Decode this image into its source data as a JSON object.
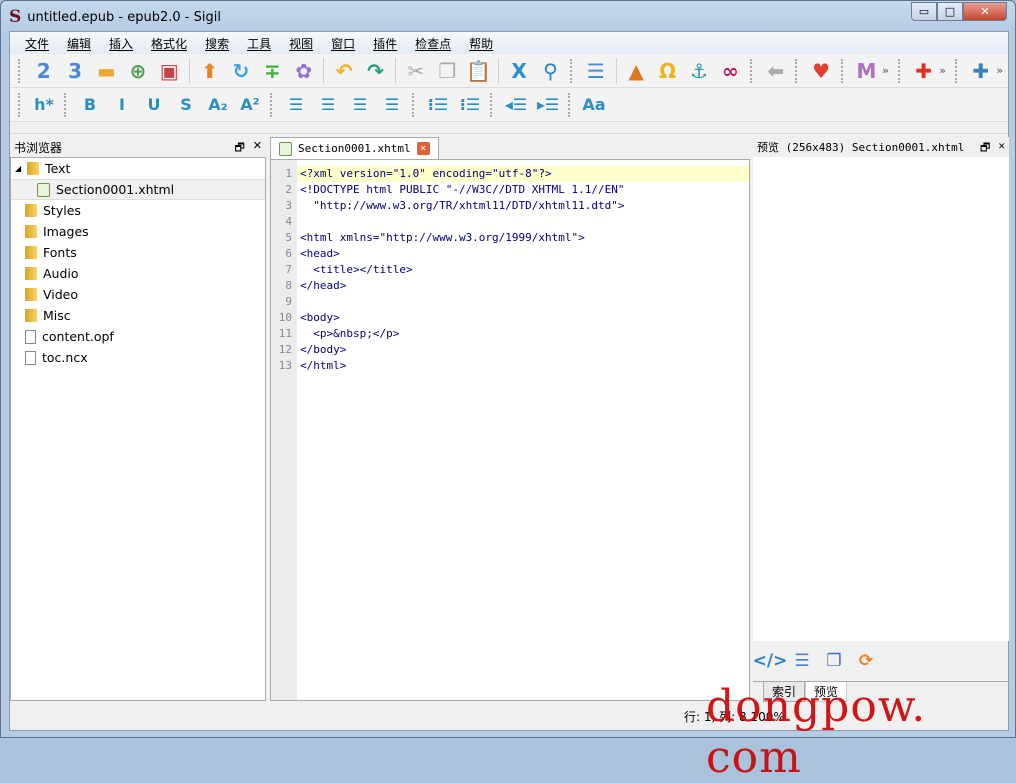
{
  "window": {
    "title": "untitled.epub - epub2.0 - Sigil",
    "logo": "S",
    "minimize": "▭",
    "maximize": "□",
    "close": "✕"
  },
  "menu": [
    "文件",
    "编辑",
    "插入",
    "格式化",
    "搜索",
    "工具",
    "视图",
    "窗口",
    "插件",
    "检查点",
    "帮助"
  ],
  "toolbar1": [
    {
      "name": "add-section-2-icon",
      "g": "2",
      "c": "#4a8ad8"
    },
    {
      "name": "add-section-3-icon",
      "g": "3",
      "c": "#4a8ad8"
    },
    {
      "name": "open-folder-icon",
      "g": "▬",
      "c": "#f0a830"
    },
    {
      "name": "add-file-icon",
      "g": "⊕",
      "c": "#4aa050"
    },
    {
      "name": "save-icon",
      "g": "▣",
      "c": "#c84048"
    },
    {
      "sep": true
    },
    {
      "name": "up-arrow-icon",
      "g": "⬆",
      "c": "#f08020"
    },
    {
      "name": "refresh-icon",
      "g": "↻",
      "c": "#40a0e0"
    },
    {
      "name": "split-icon",
      "g": "∓",
      "c": "#40b040"
    },
    {
      "name": "settings-icon",
      "g": "✿",
      "c": "#9070d0"
    },
    {
      "sep": true
    },
    {
      "name": "undo-icon",
      "g": "↶",
      "c": "#f0b020"
    },
    {
      "name": "redo-icon",
      "g": "↷",
      "c": "#20a080"
    },
    {
      "sep": true
    },
    {
      "name": "cut-icon",
      "g": "✂",
      "c": "#aaa"
    },
    {
      "name": "copy-icon",
      "g": "❐",
      "c": "#aaa"
    },
    {
      "name": "paste-icon",
      "g": "📋",
      "c": "#4a8ad8"
    },
    {
      "sep": true
    },
    {
      "name": "x-tool-icon",
      "g": "X",
      "c": "#2a90d0"
    },
    {
      "name": "search-icon",
      "g": "⚲",
      "c": "#2a80c0"
    },
    {
      "grip": true
    },
    {
      "name": "toc-icon",
      "g": "☰",
      "c": "#4a8ad8"
    },
    {
      "sep": true
    },
    {
      "name": "image-icon",
      "g": "▲",
      "c": "#e07820"
    },
    {
      "name": "omega-icon",
      "g": "Ω",
      "c": "#f0b020"
    },
    {
      "name": "anchor-icon",
      "g": "⚓",
      "c": "#20a0b0"
    },
    {
      "name": "link-icon",
      "g": "∞",
      "c": "#c01860"
    },
    {
      "grip": true
    },
    {
      "name": "back-arrow-icon",
      "g": "⬅",
      "c": "#aaa"
    },
    {
      "grip": true
    },
    {
      "name": "heart-icon",
      "g": "♥",
      "c": "#e04030"
    },
    {
      "grip": true
    },
    {
      "name": "m-plugin-icon",
      "g": "M",
      "c": "#b070c0"
    },
    {
      "chev": "»"
    },
    {
      "grip": true
    },
    {
      "name": "plugin-1-icon",
      "g": "✚",
      "c": "#e03020"
    },
    {
      "chev": "»"
    },
    {
      "grip": true
    },
    {
      "name": "plugin-6-icon",
      "g": "✚",
      "c": "#3a80c0"
    },
    {
      "chev": "»"
    }
  ],
  "toolbar2": [
    {
      "name": "heading-icon",
      "g": "h*",
      "c": "#2a90c0"
    },
    {
      "grip": true
    },
    {
      "name": "bold-icon",
      "g": "B",
      "c": "#2a90c0"
    },
    {
      "name": "italic-icon",
      "g": "I",
      "c": "#2a90c0"
    },
    {
      "name": "underline-icon",
      "g": "U",
      "c": "#2a90c0"
    },
    {
      "name": "strikethrough-icon",
      "g": "S",
      "c": "#2a90c0"
    },
    {
      "name": "subscript-icon",
      "g": "A₂",
      "c": "#2a90c0"
    },
    {
      "name": "superscript-icon",
      "g": "A²",
      "c": "#2a90c0"
    },
    {
      "grip": true
    },
    {
      "name": "align-left-icon",
      "g": "☰",
      "c": "#2a90c0"
    },
    {
      "name": "align-center-icon",
      "g": "☰",
      "c": "#2a90c0"
    },
    {
      "name": "align-right-icon",
      "g": "☰",
      "c": "#2a90c0"
    },
    {
      "name": "justify-icon",
      "g": "☰",
      "c": "#2a90c0"
    },
    {
      "grip": true
    },
    {
      "name": "bullet-list-icon",
      "g": "⁝☰",
      "c": "#2a90c0"
    },
    {
      "name": "numbered-list-icon",
      "g": "⁝☰",
      "c": "#2a90c0"
    },
    {
      "grip": true
    },
    {
      "name": "outdent-icon",
      "g": "◂☰",
      "c": "#2a90c0"
    },
    {
      "name": "indent-icon",
      "g": "▸☰",
      "c": "#2a90c0"
    },
    {
      "grip": true
    },
    {
      "name": "text-case-icon",
      "g": "Aa",
      "c": "#2a90c0"
    }
  ],
  "book_browser": {
    "title": "书浏览器",
    "float": "🗗",
    "close": "✕",
    "items": [
      {
        "label": "Text",
        "type": "folder",
        "expanded": "◢"
      },
      {
        "label": "Section0001.xhtml",
        "type": "xhtml",
        "selected": true
      },
      {
        "label": "Styles",
        "type": "folder"
      },
      {
        "label": "Images",
        "type": "folder"
      },
      {
        "label": "Fonts",
        "type": "folder"
      },
      {
        "label": "Audio",
        "type": "folder"
      },
      {
        "label": "Video",
        "type": "folder"
      },
      {
        "label": "Misc",
        "type": "folder"
      },
      {
        "label": "content.opf",
        "type": "file"
      },
      {
        "label": "toc.ncx",
        "type": "file"
      }
    ]
  },
  "editor": {
    "tab": "Section0001.xhtml",
    "tab_close": "✕",
    "lines": [
      "<?xml version=\"1.0\" encoding=\"utf-8\"?>",
      "<!DOCTYPE html PUBLIC \"-//W3C//DTD XHTML 1.1//EN\"",
      "  \"http://www.w3.org/TR/xhtml11/DTD/xhtml11.dtd\">",
      "",
      "<html xmlns=\"http://www.w3.org/1999/xhtml\">",
      "<head>",
      "  <title></title>",
      "</head>",
      "",
      "<body>",
      "  <p>&nbsp;</p>",
      "</body>",
      "</html>"
    ]
  },
  "preview": {
    "title": "预览 (256x483) Section0001.xhtml",
    "float": "🗗",
    "close": "✕",
    "icons": [
      {
        "name": "code-icon",
        "g": "</>",
        "c": "#2a80d0"
      },
      {
        "name": "select-text-icon",
        "g": "☰",
        "c": "#4a80c0"
      },
      {
        "name": "copy-page-icon",
        "g": "❐",
        "c": "#3a70c0"
      },
      {
        "name": "refresh-icon",
        "g": "⟳",
        "c": "#f08020"
      }
    ],
    "tabs": [
      {
        "label": "索引"
      },
      {
        "label": "预览",
        "active": true
      }
    ]
  },
  "status": {
    "text": "行: 1, 列: 8  100%"
  },
  "watermark": "dongpow. com"
}
